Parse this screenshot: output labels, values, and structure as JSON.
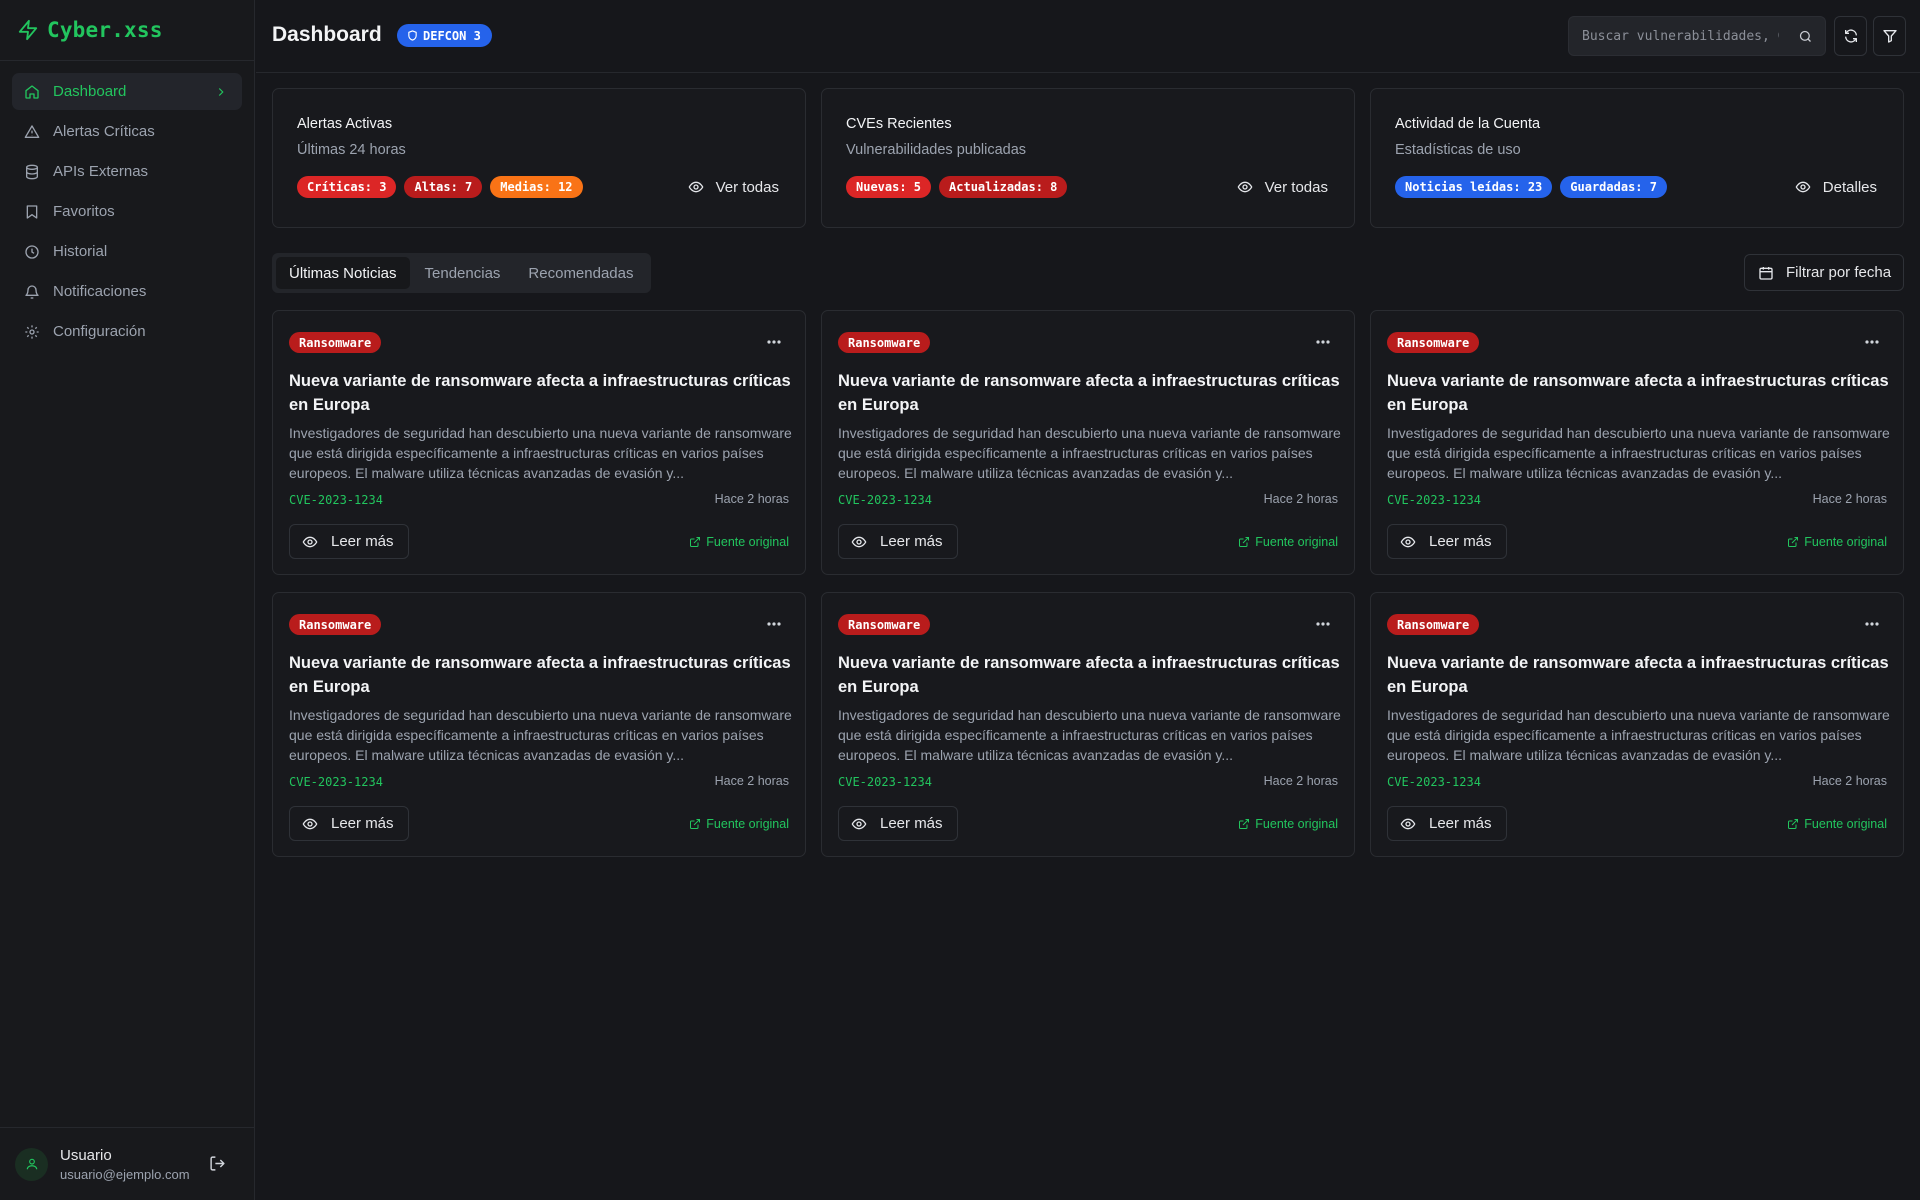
{
  "brand": {
    "name": "Cyber.xss"
  },
  "sidebar": {
    "items": [
      {
        "label": "Dashboard",
        "icon": "home-icon"
      },
      {
        "label": "Alertas Críticas",
        "icon": "alert-triangle-icon"
      },
      {
        "label": "APIs Externas",
        "icon": "database-icon"
      },
      {
        "label": "Favoritos",
        "icon": "bookmark-icon"
      },
      {
        "label": "Historial",
        "icon": "clock-icon"
      },
      {
        "label": "Notificaciones",
        "icon": "bell-icon"
      },
      {
        "label": "Configuración",
        "icon": "gear-icon"
      }
    ],
    "active": "Dashboard"
  },
  "user": {
    "name": "Usuario",
    "email": "usuario@ejemplo.com"
  },
  "header": {
    "title": "Dashboard",
    "defcon": "DEFCON 3",
    "search_placeholder": "Buscar vulnerabilidades, CVEs..."
  },
  "stats": [
    {
      "title": "Alertas Activas",
      "subtitle": "Últimas 24 horas",
      "badges": [
        {
          "label": "Críticas: 3",
          "color": "#dc2626"
        },
        {
          "label": "Altas: 7",
          "color": "#b91c1c"
        },
        {
          "label": "Medias: 12",
          "color": "#f97316"
        }
      ],
      "action": "Ver todas"
    },
    {
      "title": "CVEs Recientes",
      "subtitle": "Vulnerabilidades publicadas",
      "badges": [
        {
          "label": "Nuevas: 5",
          "color": "#dc2626"
        },
        {
          "label": "Actualizadas: 8",
          "color": "#b91c1c"
        }
      ],
      "action": "Ver todas"
    },
    {
      "title": "Actividad de la Cuenta",
      "subtitle": "Estadísticas de uso",
      "badges": [
        {
          "label": "Noticias leídas: 23",
          "color": "#2563eb"
        },
        {
          "label": "Guardadas: 7",
          "color": "#2563eb"
        }
      ],
      "action": "Detalles"
    }
  ],
  "tabs": [
    {
      "label": "Últimas Noticias",
      "active": true
    },
    {
      "label": "Tendencias",
      "active": false
    },
    {
      "label": "Recomendadas",
      "active": false
    }
  ],
  "date_filter": "Filtrar por fecha",
  "news": [
    {
      "category": "Ransomware",
      "title": "Nueva variante de ransomware afecta a infraestructuras críticas en Europa",
      "description": "Investigadores de seguridad han descubierto una nueva variante de ransomware que está dirigida específicamente a infraestructuras críticas en varios países europeos. El malware utiliza técnicas avanzadas de evasión y...",
      "cve": "CVE-2023-1234",
      "time": "Hace 2 horas",
      "read_more": "Leer más",
      "source": "Fuente original"
    },
    {
      "category": "Ransomware",
      "title": "Nueva variante de ransomware afecta a infraestructuras críticas en Europa",
      "description": "Investigadores de seguridad han descubierto una nueva variante de ransomware que está dirigida específicamente a infraestructuras críticas en varios países europeos. El malware utiliza técnicas avanzadas de evasión y...",
      "cve": "CVE-2023-1234",
      "time": "Hace 2 horas",
      "read_more": "Leer más",
      "source": "Fuente original"
    },
    {
      "category": "Ransomware",
      "title": "Nueva variante de ransomware afecta a infraestructuras críticas en Europa",
      "description": "Investigadores de seguridad han descubierto una nueva variante de ransomware que está dirigida específicamente a infraestructuras críticas en varios países europeos. El malware utiliza técnicas avanzadas de evasión y...",
      "cve": "CVE-2023-1234",
      "time": "Hace 2 horas",
      "read_more": "Leer más",
      "source": "Fuente original"
    },
    {
      "category": "Ransomware",
      "title": "Nueva variante de ransomware afecta a infraestructuras críticas en Europa",
      "description": "Investigadores de seguridad han descubierto una nueva variante de ransomware que está dirigida específicamente a infraestructuras críticas en varios países europeos. El malware utiliza técnicas avanzadas de evasión y...",
      "cve": "CVE-2023-1234",
      "time": "Hace 2 horas",
      "read_more": "Leer más",
      "source": "Fuente original"
    },
    {
      "category": "Ransomware",
      "title": "Nueva variante de ransomware afecta a infraestructuras críticas en Europa",
      "description": "Investigadores de seguridad han descubierto una nueva variante de ransomware que está dirigida específicamente a infraestructuras críticas en varios países europeos. El malware utiliza técnicas avanzadas de evasión y...",
      "cve": "CVE-2023-1234",
      "time": "Hace 2 horas",
      "read_more": "Leer más",
      "source": "Fuente original"
    },
    {
      "category": "Ransomware",
      "title": "Nueva variante de ransomware afecta a infraestructuras críticas en Europa",
      "description": "Investigadores de seguridad han descubierto una nueva variante de ransomware que está dirigida específicamente a infraestructuras críticas en varios países europeos. El malware utiliza técnicas avanzadas de evasión y...",
      "cve": "CVE-2023-1234",
      "time": "Hace 2 horas",
      "read_more": "Leer más",
      "source": "Fuente original"
    }
  ],
  "colors": {
    "accent": "#22c55e",
    "defcon": "#2563eb",
    "category": "#b91c1c",
    "background": "#16171b"
  }
}
